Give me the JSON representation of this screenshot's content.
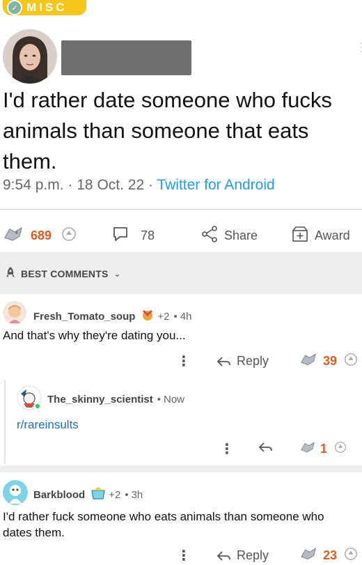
{
  "flair": {
    "text": "MISC"
  },
  "tweet": {
    "text": "I'd rather date someone who fucks animals than someone that eats them.",
    "time": "9:54 p.m.",
    "date": "18 Oct. 22",
    "source": "Twitter for Android",
    "sep": "·"
  },
  "post_actions": {
    "upvotes": "689",
    "comments": "78",
    "share_label": "Share",
    "award_label": "Award"
  },
  "section": {
    "label": "BEST COMMENTS"
  },
  "comments": [
    {
      "user": "Fresh_Tomato_soup",
      "awards": "+2",
      "time": "4h",
      "body": "And that's why they're dating you...",
      "reply_label": "Reply",
      "votes": "39"
    },
    {
      "user": "The_skinny_scientist",
      "time": "Now",
      "body": "r/rareinsults",
      "votes": "1"
    },
    {
      "user": "Barkblood",
      "awards": "+2",
      "time": "3h",
      "body": "I'd rather fuck someone who eats animals than someone who dates them.",
      "reply_label": "Reply",
      "votes": "23"
    }
  ],
  "colors": {
    "accent": "#e05b20",
    "link": "#1d9bf0",
    "flair": "#f5c518"
  }
}
